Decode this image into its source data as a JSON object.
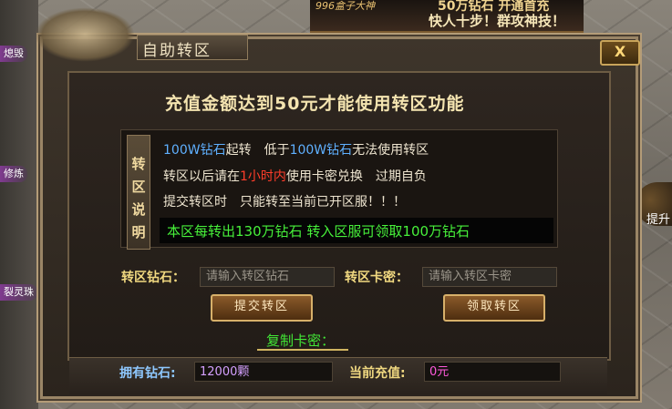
{
  "background": {
    "side_labels": [
      "熄毁",
      "修炼",
      "裂灵珠"
    ],
    "banner": {
      "line_a": "996盒子大神",
      "line_b": "50万钻石 开通首充",
      "line_c": "快人十步！群攻神技！"
    },
    "right_label": "提升"
  },
  "dialog": {
    "title": "自助转区",
    "close_label": "X",
    "headline": "充值金额达到50元才能使用转区功能",
    "notice": {
      "tag_chars": [
        "转",
        "区",
        "说",
        "明"
      ],
      "line1": {
        "a": "100W",
        "b": "钻石",
        "c": "起转　低于",
        "d": "100W",
        "e": "钻石",
        "f": "无法使用转区"
      },
      "line2": {
        "a": "转区以后请在",
        "b": "1小时内",
        "c": "使用卡密兑换　过期自负"
      },
      "line3": "提交转区时　只能转至当前已开区服！！！",
      "highlight": "本区每转出130万钻石 转入区服可领取100万钻石"
    },
    "diamond_label": "转区钻石：",
    "diamond_placeholder": "请输入转区钻石",
    "card_label": "转区卡密：",
    "card_placeholder": "请输入转区卡密",
    "submit_label": "提交转区",
    "receive_label": "领取转区",
    "copy_label": "复制卡密：",
    "owned_label": "拥有钻石:",
    "owned_value": "12000颗",
    "recharge_label": "当前充值:",
    "recharge_value": "0元"
  },
  "colors": {
    "accent_gold": "#f0d880",
    "notice_green": "#47f03a",
    "link_blue": "#5fb0ff",
    "warning_red": "#ff3d2a",
    "owned_value": "#d4a0ff",
    "recharge_value": "#ff5adc"
  }
}
